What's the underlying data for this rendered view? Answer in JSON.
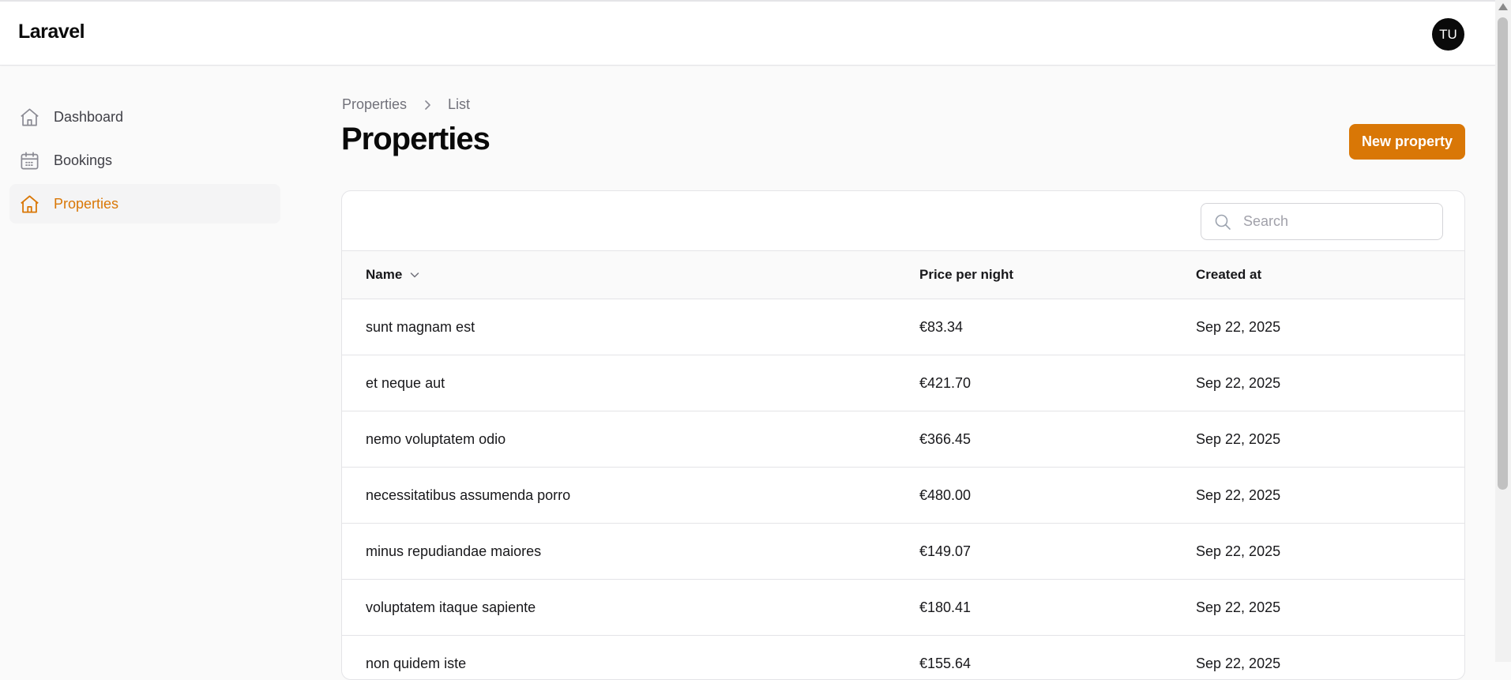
{
  "app": {
    "brand": "Laravel",
    "user_initials": "TU"
  },
  "sidebar": {
    "items": [
      {
        "label": "Dashboard",
        "icon": "home-icon",
        "active": false
      },
      {
        "label": "Bookings",
        "icon": "calendar-icon",
        "active": false
      },
      {
        "label": "Properties",
        "icon": "home-icon",
        "active": true
      }
    ]
  },
  "breadcrumb": {
    "items": [
      "Properties",
      "List"
    ]
  },
  "page": {
    "title": "Properties",
    "new_button": "New property"
  },
  "search": {
    "placeholder": "Search",
    "value": ""
  },
  "table": {
    "columns": [
      "Name",
      "Price per night",
      "Created at"
    ],
    "sorted_column": "Name",
    "rows": [
      {
        "name": "sunt magnam est",
        "price": "€83.34",
        "created": "Sep 22, 2025"
      },
      {
        "name": "et neque aut",
        "price": "€421.70",
        "created": "Sep 22, 2025"
      },
      {
        "name": "nemo voluptatem odio",
        "price": "€366.45",
        "created": "Sep 22, 2025"
      },
      {
        "name": "necessitatibus assumenda porro",
        "price": "€480.00",
        "created": "Sep 22, 2025"
      },
      {
        "name": "minus repudiandae maiores",
        "price": "€149.07",
        "created": "Sep 22, 2025"
      },
      {
        "name": "voluptatem itaque sapiente",
        "price": "€180.41",
        "created": "Sep 22, 2025"
      },
      {
        "name": "non quidem iste",
        "price": "€155.64",
        "created": "Sep 22, 2025"
      }
    ]
  },
  "colors": {
    "accent": "#d97706",
    "text": "#18181b",
    "muted": "#71717a",
    "border": "#e4e4e7"
  }
}
